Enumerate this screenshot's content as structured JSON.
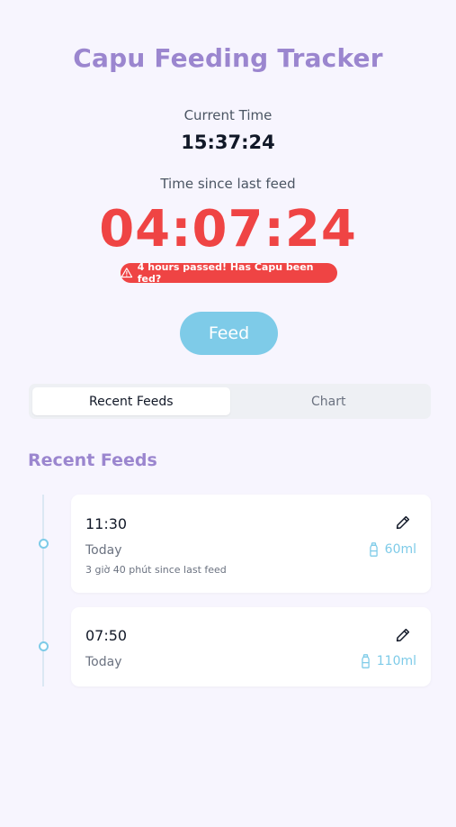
{
  "app": {
    "title": "Capu Feeding Tracker"
  },
  "clock": {
    "current_label": "Current Time",
    "current_time": "15:37:24",
    "since_label": "Time since last feed",
    "since_time": "04:07:24"
  },
  "alert": {
    "text": "4 hours passed! Has Capu been fed?",
    "icon": "warning-triangle-icon",
    "color": "#ef4444"
  },
  "feed_button": {
    "label": "Feed",
    "color": "#7ecbe8"
  },
  "tabs": [
    {
      "label": "Recent Feeds",
      "active": true
    },
    {
      "label": "Chart",
      "active": false
    }
  ],
  "recent": {
    "title": "Recent Feeds",
    "items": [
      {
        "time": "11:30",
        "day": "Today",
        "amount": "60ml",
        "note": "3 giờ 40 phút since last feed"
      },
      {
        "time": "07:50",
        "day": "Today",
        "amount": "110ml"
      }
    ]
  },
  "colors": {
    "accent_purple": "#9b86cf",
    "accent_blue": "#7ecbe8",
    "danger": "#ef4444",
    "background": "#f7f5fe"
  }
}
